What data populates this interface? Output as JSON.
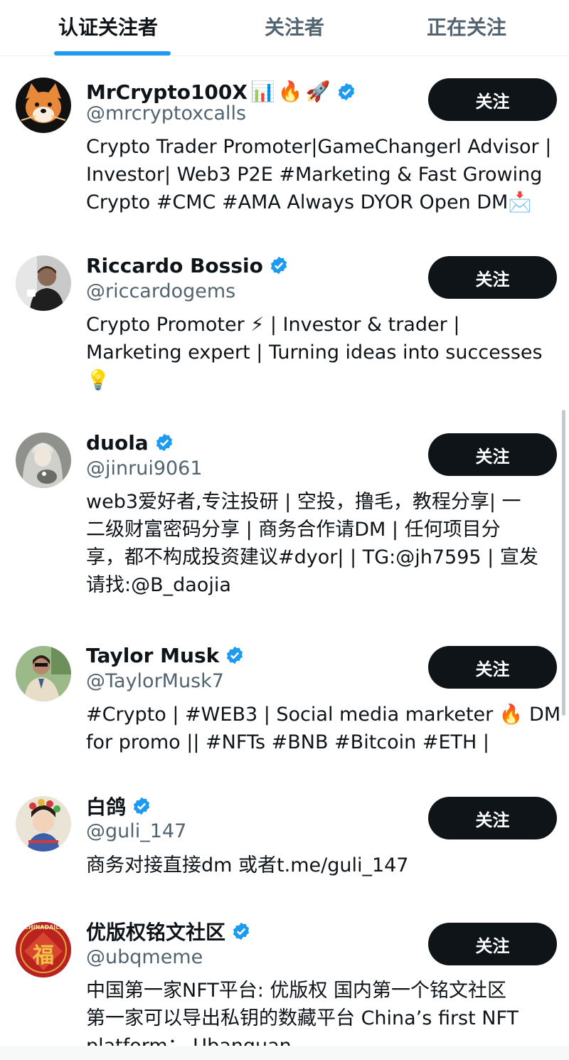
{
  "tabs": [
    {
      "label": "认证关注者",
      "active": true
    },
    {
      "label": "关注者",
      "active": false
    },
    {
      "label": "正在关注",
      "active": false
    }
  ],
  "colors": {
    "accent": "#1d9bf0",
    "button_bg": "#0f1419",
    "secondary_text": "#536471"
  },
  "follow_label": "关注",
  "users": [
    {
      "name": "MrCrypto100X",
      "emojis": [
        "📊",
        "🔥",
        "🚀"
      ],
      "verified": true,
      "handle": "@mrcryptoxcalls",
      "bio_lines": [
        "Crypto Trader Promoter|GameChangerl Advisor |",
        "Investor| Web3 P2E #Marketing & Fast Growing",
        "Crypto #CMC #AMA Always DYOR Open DM📩"
      ],
      "avatar_icon": "shiba-avatar-icon"
    },
    {
      "name": "Riccardo Bossio",
      "emojis": [],
      "verified": true,
      "handle": "@riccardogems",
      "bio_lines": [
        "Crypto Promoter ⚡ | Investor & trader |",
        "Marketing expert | Turning ideas into successes",
        "💡"
      ],
      "avatar_icon": "person-avatar-icon"
    },
    {
      "name": "duola",
      "emojis": [],
      "verified": true,
      "handle": "@jinrui9061",
      "bio_lines": [
        "web3爱好者,专注投研 | 空投，撸毛，教程分享| 一",
        "二级财富密码分享 | 商务合作请DM | 任何项目分",
        "享，都不构成投资建议#dyor| | TG:@jh7595 | 宣发",
        "请找:@B_daojia"
      ],
      "avatar_icon": "anime-avatar-icon"
    },
    {
      "name": "Taylor Musk",
      "emojis": [],
      "verified": true,
      "handle": "@TaylorMusk7",
      "bio_lines": [
        "#Crypto | #WEB3 | Social media marketer 🔥 DM",
        "for promo || #NFTs #BNB #Bitcoin #ETH |"
      ],
      "avatar_icon": "person-avatar-icon"
    },
    {
      "name": "白鸽",
      "emojis": [],
      "verified": true,
      "handle": "@guli_147",
      "bio_lines": [
        "商务对接直接dm 或者t.me/guli_147"
      ],
      "avatar_icon": "child-avatar-icon"
    },
    {
      "name": "优版权铭文社区",
      "emojis": [],
      "verified": true,
      "handle": "@ubqmeme",
      "bio_lines": [
        "中国第一家NFT平台: 优版权 国内第一个铭文社区",
        "第一家可以导出私钥的数藏平台 China’s first NFT",
        "platform： Ubanquan"
      ],
      "avatar_icon": "fu-avatar-icon",
      "avatar_text": "福",
      "avatar_caption": "CHINADAILY"
    }
  ]
}
